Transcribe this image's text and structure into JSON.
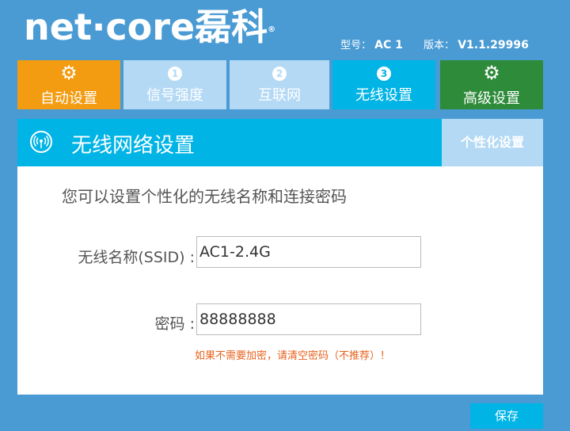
{
  "brand": {
    "logo_text": "net·core",
    "logo_cn": "磊科",
    "reg": "®"
  },
  "info": {
    "model_label": "型号：",
    "model_value": "AC 1",
    "version_label": "版本：",
    "version_value": "V1.1.29996"
  },
  "nav": {
    "auto": {
      "label": "自动设置",
      "icon": "gear-sync-icon"
    },
    "step1": {
      "num": "1",
      "label": "信号强度"
    },
    "step2": {
      "num": "2",
      "label": "互联网"
    },
    "step3": {
      "num": "3",
      "label": "无线设置"
    },
    "advanced": {
      "label": "高级设置",
      "icon": "gear-icon"
    }
  },
  "panel": {
    "title": "无线网络设置",
    "tab": "个性化设置",
    "icon": "wifi-icon"
  },
  "form": {
    "intro": "您可以设置个性化的无线名称和连接密码",
    "ssid_label": "无线名称(SSID) :",
    "ssid_value": "AC1-2.4G",
    "pwd_label": "密码 :",
    "pwd_value": "88888888",
    "hint": "如果不需要加密，请清空密码（不推荐）！"
  },
  "actions": {
    "save": "保存"
  },
  "colors": {
    "background": "#4a9bd4",
    "orange": "#f39c12",
    "cyan": "#00b4e6",
    "light_blue": "#b3d9f5",
    "green": "#2e8b3a",
    "hint": "#e8621d"
  }
}
